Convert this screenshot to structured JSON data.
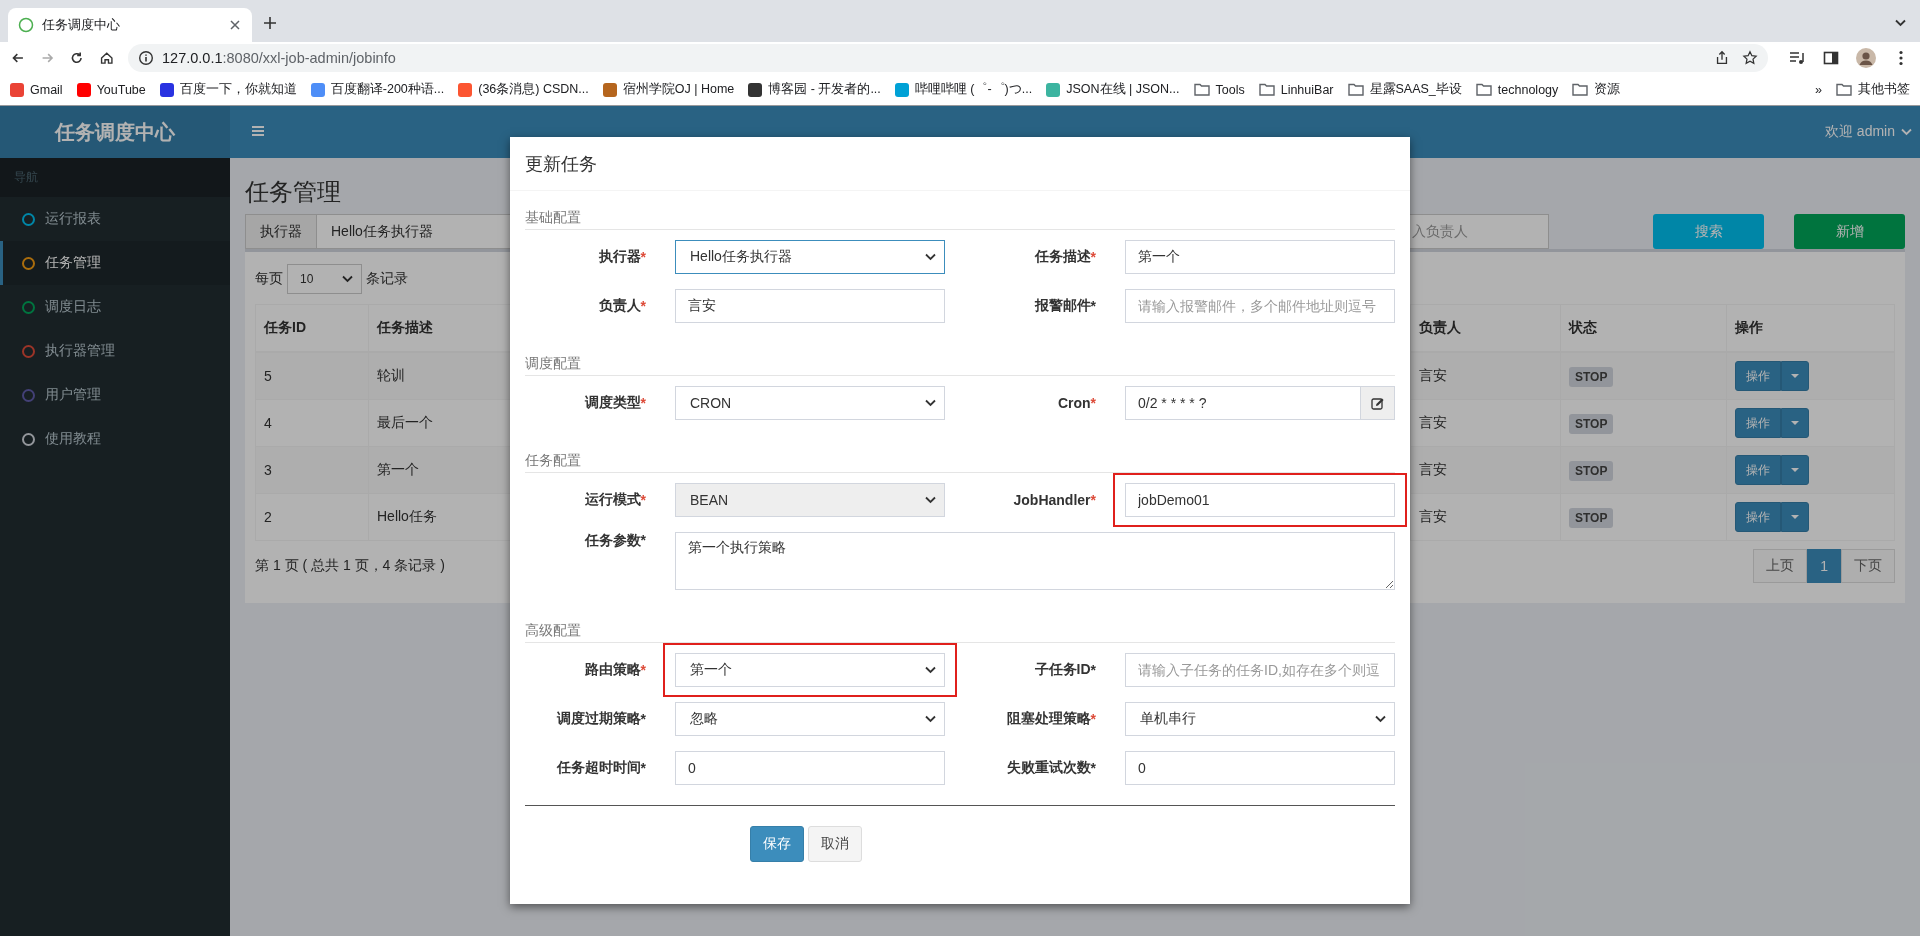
{
  "browser": {
    "tab": {
      "title": "任务调度中心",
      "selected": true
    },
    "address": {
      "host": "127.0.0.1",
      "path": ":8080/xxl-job-admin/jobinfo"
    },
    "bookmarks": [
      {
        "kind": "site",
        "label": "Gmail",
        "color": "#ea4335"
      },
      {
        "kind": "site",
        "label": "YouTube",
        "color": "#ff0000"
      },
      {
        "kind": "site",
        "label": "百度一下，你就知道",
        "color": "#2932e1"
      },
      {
        "kind": "site",
        "label": "百度翻译-200种语...",
        "color": "#4e8ef7"
      },
      {
        "kind": "site",
        "label": "(36条消息) CSDN...",
        "color": "#fc5531"
      },
      {
        "kind": "site",
        "label": "宿州学院OJ | Home",
        "color": "#b5651d"
      },
      {
        "kind": "site",
        "label": "博客园 - 开发者的...",
        "color": "#333333"
      },
      {
        "kind": "site",
        "label": "哔哩哔哩 (゜-゜)つ...",
        "color": "#00a1d6"
      },
      {
        "kind": "site",
        "label": "JSON在线 | JSON...",
        "color": "#3cb4a0"
      },
      {
        "kind": "folder",
        "label": "Tools"
      },
      {
        "kind": "folder",
        "label": "LinhuiBar"
      },
      {
        "kind": "folder",
        "label": "星露SAAS_毕设"
      },
      {
        "kind": "folder",
        "label": "technology"
      },
      {
        "kind": "folder",
        "label": "资源"
      }
    ],
    "overflow": "»",
    "other_bookmarks": "其他书签"
  },
  "header": {
    "logo": "任务调度中心",
    "user": "欢迎 admin"
  },
  "sidebar": {
    "heading": "导航",
    "items": [
      {
        "label": "运行报表",
        "color": "#0086a7",
        "selected": false
      },
      {
        "label": "任务管理",
        "color": "#aa6d0d",
        "selected": true
      },
      {
        "label": "调度日志",
        "color": "#00743f",
        "selected": false
      },
      {
        "label": "执行器管理",
        "color": "#9b3428",
        "selected": false
      },
      {
        "label": "用户管理",
        "color": "#434076",
        "selected": false
      },
      {
        "label": "使用教程",
        "color": "#93969b",
        "selected": false
      }
    ]
  },
  "page": {
    "title": "任务管理",
    "filter": {
      "executor_label": "执行器",
      "executor_value": "Hello任务执行器",
      "person_placeholder": "入负责人",
      "search": "搜索",
      "add": "新增"
    },
    "per_page": {
      "before": "每页",
      "value": "10",
      "after": "条记录"
    },
    "table": {
      "columns": [
        "任务ID",
        "任务描述",
        "负责人",
        "状态",
        "操作"
      ],
      "rows": [
        {
          "id": "5",
          "desc": "轮训",
          "owner": "言安",
          "status": "STOP",
          "action": "操作"
        },
        {
          "id": "4",
          "desc": "最后一个",
          "owner": "言安",
          "status": "STOP",
          "action": "操作"
        },
        {
          "id": "3",
          "desc": "第一个",
          "owner": "言安",
          "status": "STOP",
          "action": "操作"
        },
        {
          "id": "2",
          "desc": "Hello任务",
          "owner": "言安",
          "status": "STOP",
          "action": "操作"
        }
      ]
    },
    "summary": "第 1 页 ( 总共 1 页，4 条记录 )",
    "pagination": [
      {
        "label": "上页",
        "selected": false
      },
      {
        "label": "1",
        "selected": true
      },
      {
        "label": "下页",
        "selected": false
      }
    ]
  },
  "modal": {
    "title": "更新任务",
    "sections": [
      {
        "title": "基础配置",
        "fields": [
          {
            "label": "执行器",
            "star": {
              "text": "*",
              "color": "#dd4b39"
            },
            "kind": "select",
            "value": "Hello任务执行器",
            "focused": true,
            "disabled": false,
            "highlight": false
          },
          {
            "label": "任务描述",
            "star": {
              "text": "*",
              "color": "#dd4b39"
            },
            "kind": "input",
            "value": "第一个",
            "focused": false,
            "disabled": false,
            "highlight": false
          },
          {
            "label": "负责人",
            "star": {
              "text": "*",
              "color": "#dd4b39"
            },
            "kind": "input",
            "value": "言安",
            "focused": false,
            "disabled": false,
            "highlight": false
          },
          {
            "label": "报警邮件",
            "star": {
              "text": "*",
              "color": "#333333"
            },
            "kind": "input",
            "placeholder": "请输入报警邮件，多个邮件地址则逗号",
            "focused": false,
            "disabled": false,
            "highlight": false
          }
        ]
      },
      {
        "title": "调度配置",
        "fields": [
          {
            "label": "调度类型",
            "star": {
              "text": "*",
              "color": "#dd4b39"
            },
            "kind": "select",
            "value": "CRON",
            "focused": false,
            "disabled": false,
            "highlight": false
          },
          {
            "label": "Cron",
            "star": {
              "text": "*",
              "color": "#dd4b39"
            },
            "kind": "addon",
            "value": "0/2 * * * * ?",
            "focused": false,
            "disabled": false,
            "highlight": false
          }
        ]
      },
      {
        "title": "任务配置",
        "fields": [
          {
            "label": "运行模式",
            "star": {
              "text": "*",
              "color": "#dd4b39"
            },
            "kind": "select",
            "value": "BEAN",
            "focused": false,
            "disabled": true,
            "highlight": false
          },
          {
            "label": "JobHandler",
            "star": {
              "text": "*",
              "color": "#dd4b39"
            },
            "kind": "input",
            "value": "jobDemo01",
            "focused": false,
            "disabled": false,
            "highlight": true
          },
          {
            "label": "任务参数",
            "star": {
              "text": "*",
              "color": "#333333"
            },
            "kind": "textarea",
            "value": "第一个执行策略",
            "focused": false,
            "disabled": false,
            "highlight": false
          }
        ]
      },
      {
        "title": "高级配置",
        "fields": [
          {
            "label": "路由策略",
            "star": {
              "text": "*",
              "color": "#dd4b39"
            },
            "kind": "select",
            "value": "第一个",
            "focused": false,
            "disabled": false,
            "highlight": true
          },
          {
            "label": "子任务ID",
            "star": {
              "text": "*",
              "color": "#333333"
            },
            "kind": "input",
            "placeholder": "请输入子任务的任务ID,如存在多个则逗",
            "focused": false,
            "disabled": false,
            "highlight": false
          },
          {
            "label": "调度过期策略",
            "star": {
              "text": "*",
              "color": "#333333"
            },
            "kind": "select",
            "value": "忽略",
            "focused": false,
            "disabled": false,
            "highlight": false
          },
          {
            "label": "阻塞处理策略",
            "star": {
              "text": "*",
              "color": "#dd4b39"
            },
            "kind": "select",
            "value": "单机串行",
            "focused": false,
            "disabled": false,
            "highlight": false
          },
          {
            "label": "任务超时时间",
            "star": {
              "text": "*",
              "color": "#333333"
            },
            "kind": "input",
            "value": "0",
            "focused": false,
            "disabled": false,
            "highlight": false
          },
          {
            "label": "失败重试次数",
            "star": {
              "text": "*",
              "color": "#333333"
            },
            "kind": "input",
            "value": "0",
            "focused": false,
            "disabled": false,
            "highlight": false
          }
        ]
      }
    ],
    "buttons": [
      {
        "label": "保存",
        "kind": "primary"
      },
      {
        "label": "取消",
        "kind": "default"
      }
    ]
  }
}
